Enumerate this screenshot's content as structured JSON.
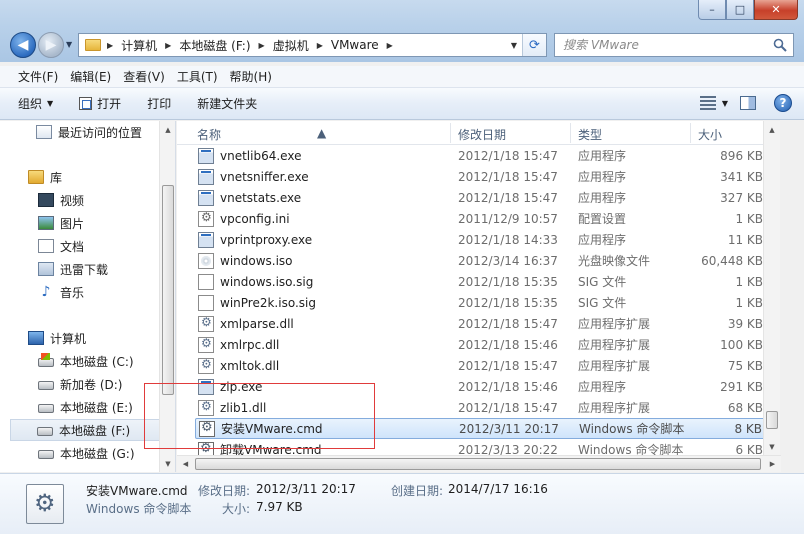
{
  "window": {
    "caption_minimize": "–",
    "caption_maximize": "□",
    "caption_close": "✕"
  },
  "address": {
    "crumbs": [
      "计算机",
      "本地磁盘 (F:)",
      "虚拟机",
      "VMware"
    ],
    "search_placeholder": "搜索 VMware"
  },
  "menu": [
    "文件(F)",
    "编辑(E)",
    "查看(V)",
    "工具(T)",
    "帮助(H)"
  ],
  "toolbar": {
    "organize": "组织",
    "open": "打开",
    "print": "打印",
    "new_folder": "新建文件夹"
  },
  "nav": {
    "recent": "最近访问的位置",
    "library": "库",
    "videos": "视频",
    "pictures": "图片",
    "documents": "文档",
    "xunlei": "迅雷下载",
    "music": "音乐",
    "computer": "计算机",
    "drive_c": "本地磁盘 (C:)",
    "drive_d": "新加卷 (D:)",
    "drive_e": "本地磁盘 (E:)",
    "drive_f": "本地磁盘 (F:)",
    "drive_g": "本地磁盘 (G:)"
  },
  "columns": {
    "name": "名称",
    "date": "修改日期",
    "type": "类型",
    "size": "大小"
  },
  "files": [
    {
      "name": "vnetlib64.exe",
      "date": "2012/1/18 15:47",
      "type": "应用程序",
      "size": "896 KB",
      "icon": "exe"
    },
    {
      "name": "vnetsniffer.exe",
      "date": "2012/1/18 15:47",
      "type": "应用程序",
      "size": "341 KB",
      "icon": "exe"
    },
    {
      "name": "vnetstats.exe",
      "date": "2012/1/18 15:47",
      "type": "应用程序",
      "size": "327 KB",
      "icon": "exe"
    },
    {
      "name": "vpconfig.ini",
      "date": "2011/12/9 10:57",
      "type": "配置设置",
      "size": "1 KB",
      "icon": "cfg"
    },
    {
      "name": "vprintproxy.exe",
      "date": "2012/1/18 14:33",
      "type": "应用程序",
      "size": "11 KB",
      "icon": "exe"
    },
    {
      "name": "windows.iso",
      "date": "2012/3/14 16:37",
      "type": "光盘映像文件",
      "size": "60,448 KB",
      "icon": "iso"
    },
    {
      "name": "windows.iso.sig",
      "date": "2012/1/18 15:35",
      "type": "SIG 文件",
      "size": "1 KB",
      "icon": "blank"
    },
    {
      "name": "winPre2k.iso.sig",
      "date": "2012/1/18 15:35",
      "type": "SIG 文件",
      "size": "1 KB",
      "icon": "blank"
    },
    {
      "name": "xmlparse.dll",
      "date": "2012/1/18 15:47",
      "type": "应用程序扩展",
      "size": "39 KB",
      "icon": "dll"
    },
    {
      "name": "xmlrpc.dll",
      "date": "2012/1/18 15:46",
      "type": "应用程序扩展",
      "size": "100 KB",
      "icon": "dll"
    },
    {
      "name": "xmltok.dll",
      "date": "2012/1/18 15:47",
      "type": "应用程序扩展",
      "size": "75 KB",
      "icon": "dll"
    },
    {
      "name": "zip.exe",
      "date": "2012/1/18 15:46",
      "type": "应用程序",
      "size": "291 KB",
      "icon": "exe"
    },
    {
      "name": "zlib1.dll",
      "date": "2012/1/18 15:47",
      "type": "应用程序扩展",
      "size": "68 KB",
      "icon": "dll"
    },
    {
      "name": "安装VMware.cmd",
      "date": "2012/3/11 20:17",
      "type": "Windows 命令脚本",
      "size": "8 KB",
      "icon": "cmd",
      "selected": true
    },
    {
      "name": "卸载VMware.cmd",
      "date": "2012/3/13 20:22",
      "type": "Windows 命令脚本",
      "size": "6 KB",
      "icon": "cmd"
    }
  ],
  "details": {
    "filename": "安装VMware.cmd",
    "filetype": "Windows 命令脚本",
    "modified_label": "修改日期:",
    "modified_value": "2012/3/11 20:17",
    "created_label": "创建日期:",
    "created_value": "2014/7/17 16:16",
    "size_label": "大小:",
    "size_value": "7.97 KB"
  }
}
